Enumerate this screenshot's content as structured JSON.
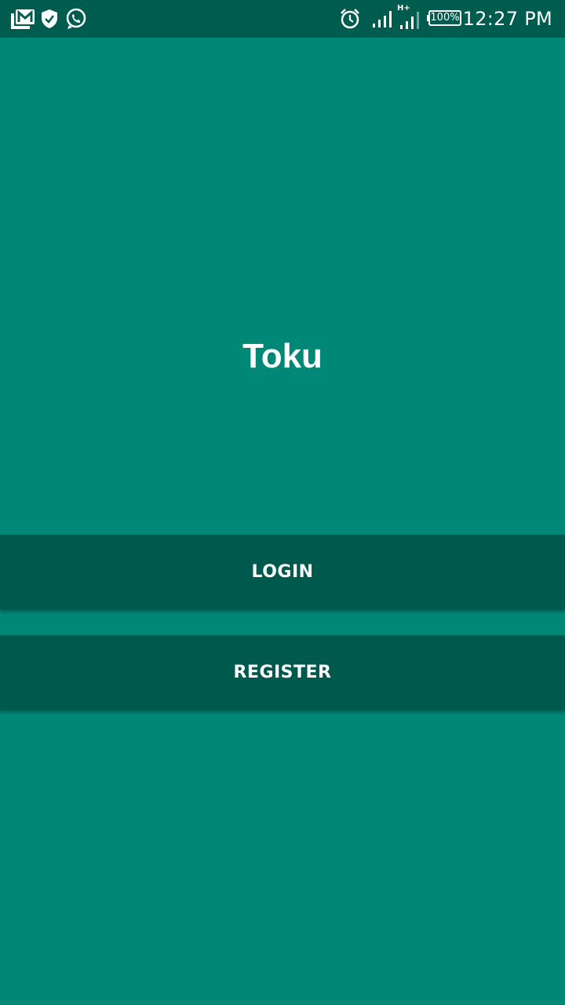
{
  "status_bar": {
    "time": "12:27 PM",
    "battery": "100%",
    "network": "H+",
    "icons": [
      "gmail-icon",
      "shield-icon",
      "whatsapp-icon",
      "alarm-icon",
      "signal-icon",
      "signal-h-plus-icon",
      "battery-icon"
    ]
  },
  "app": {
    "title": "Toku"
  },
  "buttons": {
    "login": "LOGIN",
    "register": "REGISTER"
  },
  "colors": {
    "background": "#008877",
    "status_bar": "#005c4f",
    "button": "#00594d",
    "text": "#ffffff"
  }
}
